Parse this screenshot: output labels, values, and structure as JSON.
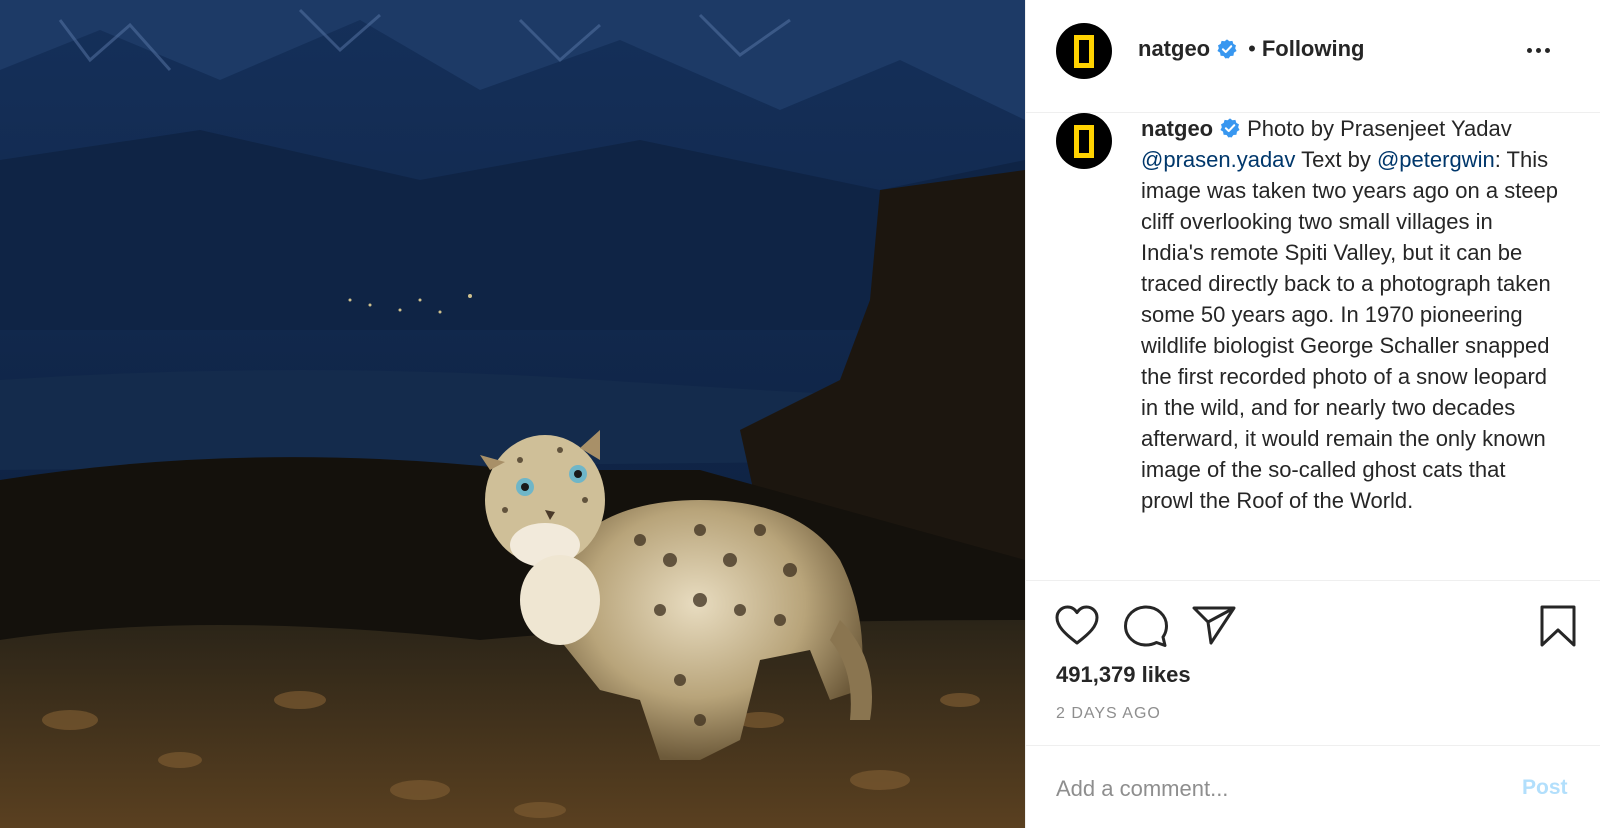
{
  "post": {
    "account": {
      "username": "natgeo",
      "verified": true,
      "follow_status": "Following",
      "separator": "•",
      "avatar_icon": "natgeo-yellow-frame-logo"
    },
    "menu_icon": "more-options-icon",
    "caption": {
      "author": "natgeo",
      "lead": "Photo by Prasenjeet Yadav",
      "mention_photographer": "@prasen.yadav",
      "text_by": "Text by",
      "mention_writer": "@petergwin",
      "colon": ":",
      "body": "This image was taken two years ago on a steep cliff overlooking two small villages in India's remote Spiti Valley, but it can be traced directly back to a photograph taken some 50 years ago. In 1970 pioneering wildlife biologist George Schaller snapped the first recorded photo of a snow leopard in the wild, and for nearly two decades afterward, it would remain the only known image of the so-called ghost cats that prowl the Roof of the World."
    },
    "actions": {
      "like_icon": "heart-icon",
      "comment_icon": "comment-icon",
      "share_icon": "paper-plane-icon",
      "save_icon": "bookmark-icon"
    },
    "likes_text": "491,379 likes",
    "timestamp": "2 DAYS AGO",
    "comment_box": {
      "placeholder": "Add a comment...",
      "post_label": "Post"
    },
    "colors": {
      "verified_badge": "#3897f0",
      "mention": "#00376b",
      "post_disabled": "#b2dffc",
      "logo_yellow": "#ffd200"
    }
  }
}
